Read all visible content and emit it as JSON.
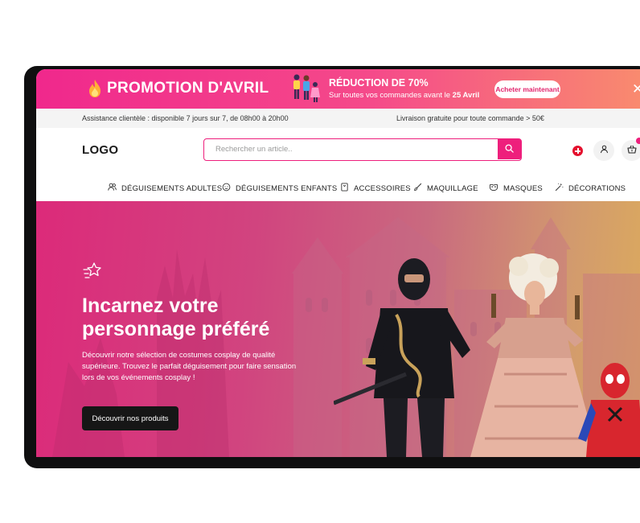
{
  "promo": {
    "title": "PROMOTION D'AVRIL",
    "discount_title": "RÉDUCTION DE 70%",
    "discount_sub_prefix": "Sur toutes vos commandes avant le ",
    "discount_sub_date": "25 Avril",
    "button_label": "Acheter maintenant",
    "close_label": "✕"
  },
  "infobar": {
    "support": "Assistance clientèle : disponible 7 jours sur 7, de 08h00 à 20h00",
    "shipping": "Livraison gratuite pour toute commande > 50€"
  },
  "header": {
    "logo": "LOGO",
    "search_placeholder": "Rechercher un article..",
    "icons": [
      "swiss-flag-icon",
      "user-icon",
      "basket-icon"
    ]
  },
  "nav": {
    "items": [
      {
        "label": "DÉGUISEMENTS ADULTES",
        "icon": "users-icon"
      },
      {
        "label": "DÉGUISEMENTS ENFANTS",
        "icon": "child-icon"
      },
      {
        "label": "ACCESSOIRES",
        "icon": "bookmark-icon"
      },
      {
        "label": "MAQUILLAGE",
        "icon": "brush-icon"
      },
      {
        "label": "MASQUES",
        "icon": "mask-icon"
      },
      {
        "label": "DÉCORATIONS",
        "icon": "magic-wand-icon"
      }
    ]
  },
  "hero": {
    "title": "Incarnez votre personnage préféré",
    "description": "Découvrir notre sélection de costumes cosplay de qualité supérieure. Trouvez le parfait déguisement pour faire sensation lors de vos événements cosplay !",
    "button_label": "Découvrir nos produits"
  },
  "colors": {
    "accent": "#ee1f7c",
    "promo_start": "#f0288c",
    "promo_end": "#f98c6e",
    "dark": "#161616"
  }
}
